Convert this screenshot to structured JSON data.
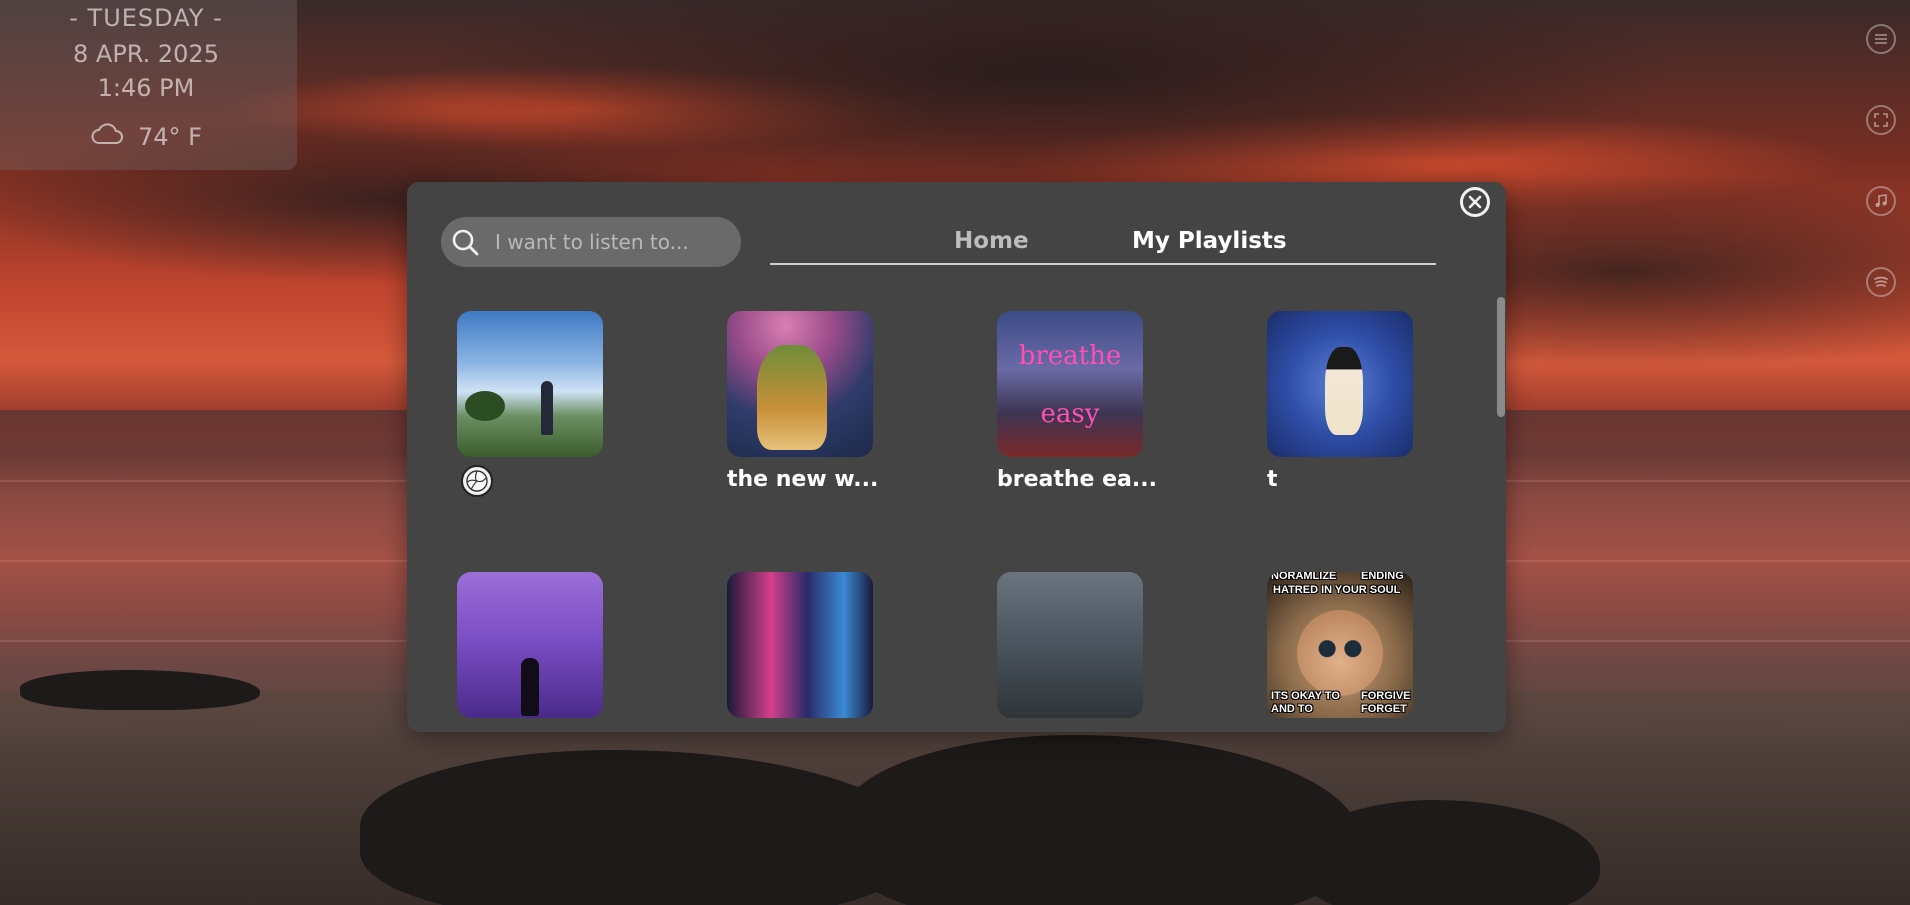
{
  "clock": {
    "day": "- TUESDAY -",
    "date": "8 APR. 2025",
    "time": "1:46 PM",
    "weather_icon": "cloud-icon",
    "temperature": "74° F"
  },
  "side_icons": [
    "menu-icon",
    "fullscreen-icon",
    "music-note-icon",
    "spotify-icon"
  ],
  "search": {
    "placeholder": "I want to listen to..."
  },
  "tabs": {
    "home": "Home",
    "my_playlists": "My Playlists",
    "active": "my_playlists"
  },
  "playlists": [
    {
      "title": "",
      "badge": "volleyball-icon"
    },
    {
      "title": "the new w..."
    },
    {
      "title": "breathe ea...",
      "cover_text": [
        "breathe",
        "easy"
      ]
    },
    {
      "title": "t"
    },
    {
      "title": ""
    },
    {
      "title": ""
    },
    {
      "title": ""
    },
    {
      "title": "",
      "cover_text": [
        "NORAMLIZE",
        "ENDING",
        "HATRED IN YOUR SOUL",
        "ITS OKAY TO",
        "FORGIVE",
        "AND TO",
        "FORGET"
      ]
    }
  ],
  "colors": {
    "modal_bg": "#444444",
    "search_bg": "#6a6a6a",
    "active_tab": "#ffffff",
    "inactive_tab": "#bdbdbd"
  }
}
